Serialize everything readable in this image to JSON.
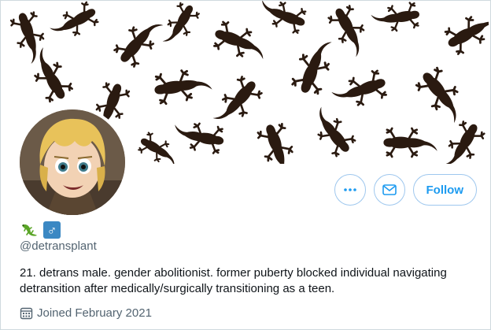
{
  "profile": {
    "handle": "@detransplant",
    "bio": "21. detrans male. gender abolitionist. former puberty blocked individual navigating detransition after medically/surgically transitioning as a teen.",
    "joined": "Joined February 2021",
    "name_emojis": [
      "lizard-emoji",
      "male-sign-emoji"
    ],
    "male_symbol": "♂"
  },
  "actions": {
    "more_icon": "more-dots-icon",
    "message_icon": "envelope-icon",
    "follow_label": "Follow"
  },
  "colors": {
    "accent": "#1d9bf0",
    "banner_pattern": "#2a1a10",
    "muted_text": "#536471",
    "male_badge": "#3b88c3",
    "lizard_green": "#5aa527"
  }
}
